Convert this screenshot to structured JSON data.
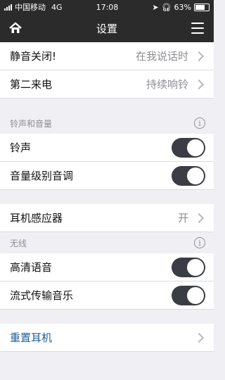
{
  "status_bar": {
    "carrier": "中国移动",
    "network": "4G",
    "time": "17:08",
    "battery": "63%"
  },
  "nav": {
    "title": "设置"
  },
  "rows_top": [
    {
      "label": "静音关闭!",
      "value": "在我说话时"
    },
    {
      "label": "第二来电",
      "value": "持续响铃"
    }
  ],
  "section_sound": {
    "header": "铃声和音量",
    "rows": [
      {
        "label": "铃声",
        "toggle": true
      },
      {
        "label": "音量级别音调",
        "toggle": true
      }
    ]
  },
  "row_sensor": {
    "label": "耳机感应器",
    "value": "开"
  },
  "section_wireless": {
    "header": "无线",
    "rows": [
      {
        "label": "高清语音",
        "toggle": true
      },
      {
        "label": "流式传输音乐",
        "toggle": true
      }
    ]
  },
  "row_reset": {
    "label": "重置耳机"
  },
  "colors": {
    "bar": "#2b2b2b",
    "toggle_on": "#3a3d44",
    "link": "#1e5d97"
  }
}
